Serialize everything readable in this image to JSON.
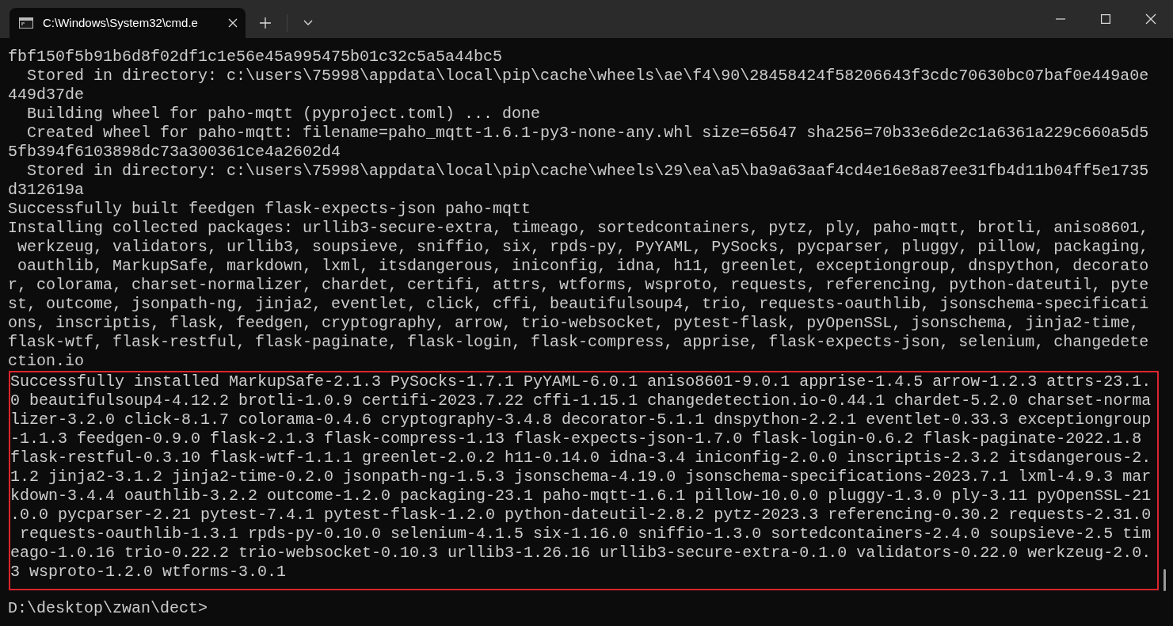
{
  "tab": {
    "title": "C:\\Windows\\System32\\cmd.e"
  },
  "terminal": {
    "lines": [
      "fbf150f5b91b6d8f02df1c1e56e45a995475b01c32c5a5a44bc5",
      "  Stored in directory: c:\\users\\75998\\appdata\\local\\pip\\cache\\wheels\\ae\\f4\\90\\28458424f58206643f3cdc70630bc07baf0e449a0e",
      "449d37de",
      "  Building wheel for paho-mqtt (pyproject.toml) ... done",
      "  Created wheel for paho-mqtt: filename=paho_mqtt-1.6.1-py3-none-any.whl size=65647 sha256=70b33e6de2c1a6361a229c660a5d5",
      "5fb394f6103898dc73a300361ce4a2602d4",
      "  Stored in directory: c:\\users\\75998\\appdata\\local\\pip\\cache\\wheels\\29\\ea\\a5\\ba9a63aaf4cd4e16e8a87ee31fb4d11b04ff5e1735",
      "d312619a",
      "Successfully built feedgen flask-expects-json paho-mqtt",
      "Installing collected packages: urllib3-secure-extra, timeago, sortedcontainers, pytz, ply, paho-mqtt, brotli, aniso8601,",
      " werkzeug, validators, urllib3, soupsieve, sniffio, six, rpds-py, PyYAML, PySocks, pycparser, pluggy, pillow, packaging,",
      " oauthlib, MarkupSafe, markdown, lxml, itsdangerous, iniconfig, idna, h11, greenlet, exceptiongroup, dnspython, decorato",
      "r, colorama, charset-normalizer, chardet, certifi, attrs, wtforms, wsproto, requests, referencing, python-dateutil, pyte",
      "st, outcome, jsonpath-ng, jinja2, eventlet, click, cffi, beautifulsoup4, trio, requests-oauthlib, jsonschema-specificati",
      "ons, inscriptis, flask, feedgen, cryptography, arrow, trio-websocket, pytest-flask, pyOpenSSL, jsonschema, jinja2-time,",
      "flask-wtf, flask-restful, flask-paginate, flask-login, flask-compress, apprise, flask-expects-json, selenium, changedete",
      "ction.io"
    ],
    "highlighted_lines": [
      "Successfully installed MarkupSafe-2.1.3 PySocks-1.7.1 PyYAML-6.0.1 aniso8601-9.0.1 apprise-1.4.5 arrow-1.2.3 attrs-23.1.",
      "0 beautifulsoup4-4.12.2 brotli-1.0.9 certifi-2023.7.22 cffi-1.15.1 changedetection.io-0.44.1 chardet-5.2.0 charset-norma",
      "lizer-3.2.0 click-8.1.7 colorama-0.4.6 cryptography-3.4.8 decorator-5.1.1 dnspython-2.2.1 eventlet-0.33.3 exceptiongroup",
      "-1.1.3 feedgen-0.9.0 flask-2.1.3 flask-compress-1.13 flask-expects-json-1.7.0 flask-login-0.6.2 flask-paginate-2022.1.8",
      "flask-restful-0.3.10 flask-wtf-1.1.1 greenlet-2.0.2 h11-0.14.0 idna-3.4 iniconfig-2.0.0 inscriptis-2.3.2 itsdangerous-2.",
      "1.2 jinja2-3.1.2 jinja2-time-0.2.0 jsonpath-ng-1.5.3 jsonschema-4.19.0 jsonschema-specifications-2023.7.1 lxml-4.9.3 mar",
      "kdown-3.4.4 oauthlib-3.2.2 outcome-1.2.0 packaging-23.1 paho-mqtt-1.6.1 pillow-10.0.0 pluggy-1.3.0 ply-3.11 pyOpenSSL-21",
      ".0.0 pycparser-2.21 pytest-7.4.1 pytest-flask-1.2.0 python-dateutil-2.8.2 pytz-2023.3 referencing-0.30.2 requests-2.31.0",
      " requests-oauthlib-1.3.1 rpds-py-0.10.0 selenium-4.1.5 six-1.16.0 sniffio-1.3.0 sortedcontainers-2.4.0 soupsieve-2.5 tim",
      "eago-1.0.16 trio-0.22.2 trio-websocket-0.10.3 urllib3-1.26.16 urllib3-secure-extra-0.1.0 validators-0.22.0 werkzeug-2.0.",
      "3 wsproto-1.2.0 wtforms-3.0.1"
    ],
    "prompt": "D:\\desktop\\zwan\\dect>"
  }
}
